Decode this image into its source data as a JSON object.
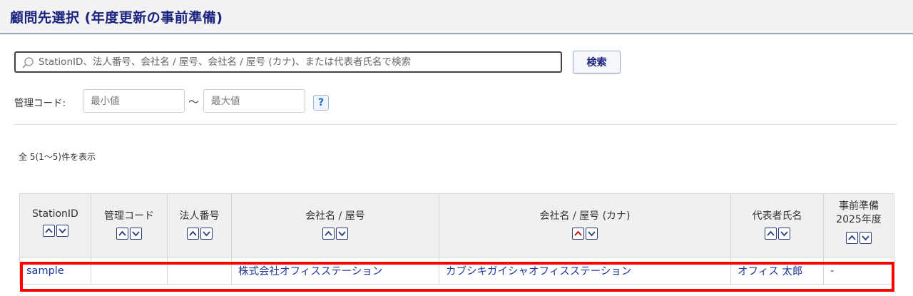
{
  "header": {
    "title": "顧問先選択 (年度更新の事前準備)"
  },
  "search": {
    "placeholder": "StationID、法人番号、会社名 / 屋号、会社名 / 屋号 (カナ)、または代表者氏名で検索",
    "button_label": "検索"
  },
  "filters": {
    "code_label": "管理コード:",
    "min_placeholder": "最小値",
    "max_placeholder": "最大値",
    "range_separator": "〜",
    "help_label": "?"
  },
  "results": {
    "summary": "全 5(1〜5)件を表示",
    "columns": [
      {
        "label": "StationID"
      },
      {
        "label": "管理コード"
      },
      {
        "label": "法人番号"
      },
      {
        "label": "会社名 / 屋号"
      },
      {
        "label": "会社名 / 屋号 (カナ)"
      },
      {
        "label": "代表者氏名"
      },
      {
        "label_line1": "事前準備",
        "label_line2": "2025年度"
      }
    ],
    "rows": [
      {
        "station_id": "sample",
        "management_code": "",
        "corporate_number": "",
        "company_name": "株式会社オフィスステーション",
        "company_name_kana": "カブシキガイシャオフィスステーション",
        "representative": "オフィス 太郎",
        "prep_2025": "-"
      }
    ]
  },
  "colors": {
    "title": "#1a237e",
    "link": "#1a3a9a",
    "highlight": "#ff0000",
    "active_sort": "#d00000"
  }
}
